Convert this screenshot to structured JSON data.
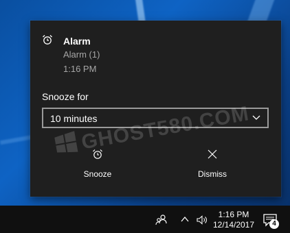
{
  "toast": {
    "title": "Alarm",
    "subtitle": "Alarm (1)",
    "time": "1:16 PM",
    "snooze_label": "Snooze for",
    "snooze_value": "10 minutes",
    "actions": [
      {
        "label": "Snooze",
        "icon": "alarm-clock-icon"
      },
      {
        "label": "Dismiss",
        "icon": "close-icon"
      }
    ]
  },
  "watermark": "GHOST580.COM",
  "taskbar": {
    "time": "1:16 PM",
    "date": "12/14/2017",
    "notification_count": "4"
  },
  "colors": {
    "toast_bg": "#1f1f1f",
    "taskbar_bg": "#101010",
    "desktop_blue": "#0e63c4",
    "secondary_text": "#a6a6a6"
  }
}
